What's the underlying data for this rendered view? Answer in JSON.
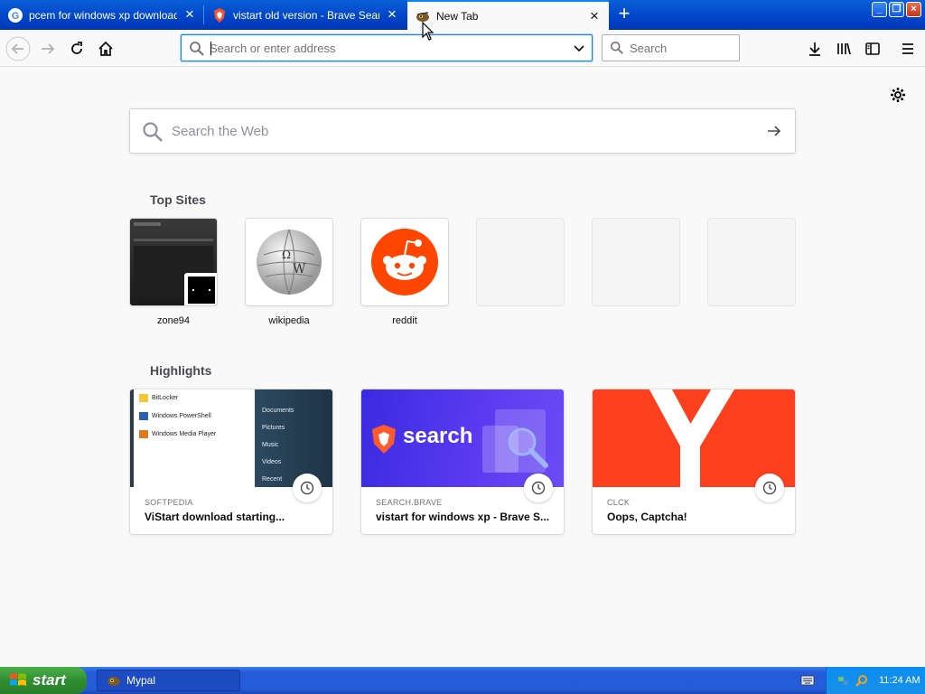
{
  "window": {
    "tabs": [
      {
        "title": "pcem for windows xp download - Go",
        "favicon": "google-icon",
        "active": false
      },
      {
        "title": "vistart old version - Brave Search",
        "favicon": "brave-icon",
        "active": false
      },
      {
        "title": "New Tab",
        "favicon": "mypal-icon",
        "active": true
      }
    ],
    "new_tab_label": "+"
  },
  "toolbar": {
    "url_placeholder": "Search or enter address",
    "search_placeholder": "Search"
  },
  "newtab": {
    "search_placeholder": "Search the Web",
    "top_sites_heading": "Top Sites",
    "top_sites": [
      {
        "label": "zone94"
      },
      {
        "label": "wikipedia"
      },
      {
        "label": "reddit"
      },
      {
        "label": ""
      },
      {
        "label": ""
      },
      {
        "label": ""
      }
    ],
    "highlights_heading": "Highlights",
    "highlights": [
      {
        "source": "SOFTPEDIA",
        "title": "ViStart download starting..."
      },
      {
        "source": "SEARCH.BRAVE",
        "title": "vistart for windows xp - Brave S..."
      },
      {
        "source": "CLCK",
        "title": "Oops, Captcha!"
      }
    ],
    "brave_banner_text": "search",
    "softpedia_menu": {
      "left": [
        "BitLocker",
        "Windows PowerShell",
        "Windows Media Player"
      ],
      "right": [
        "Documents",
        "Pictures",
        "Music",
        "Videos",
        "Recent"
      ]
    }
  },
  "taskbar": {
    "start_label": "start",
    "task_label": "Mypal",
    "clock": "11:24 AM"
  },
  "colors": {
    "accent": "#0a84ff",
    "reddit": "#ff4500",
    "yandex": "#fc3f1d",
    "brave_gradient_start": "#3a2be0",
    "brave_gradient_end": "#6a4bf5"
  }
}
